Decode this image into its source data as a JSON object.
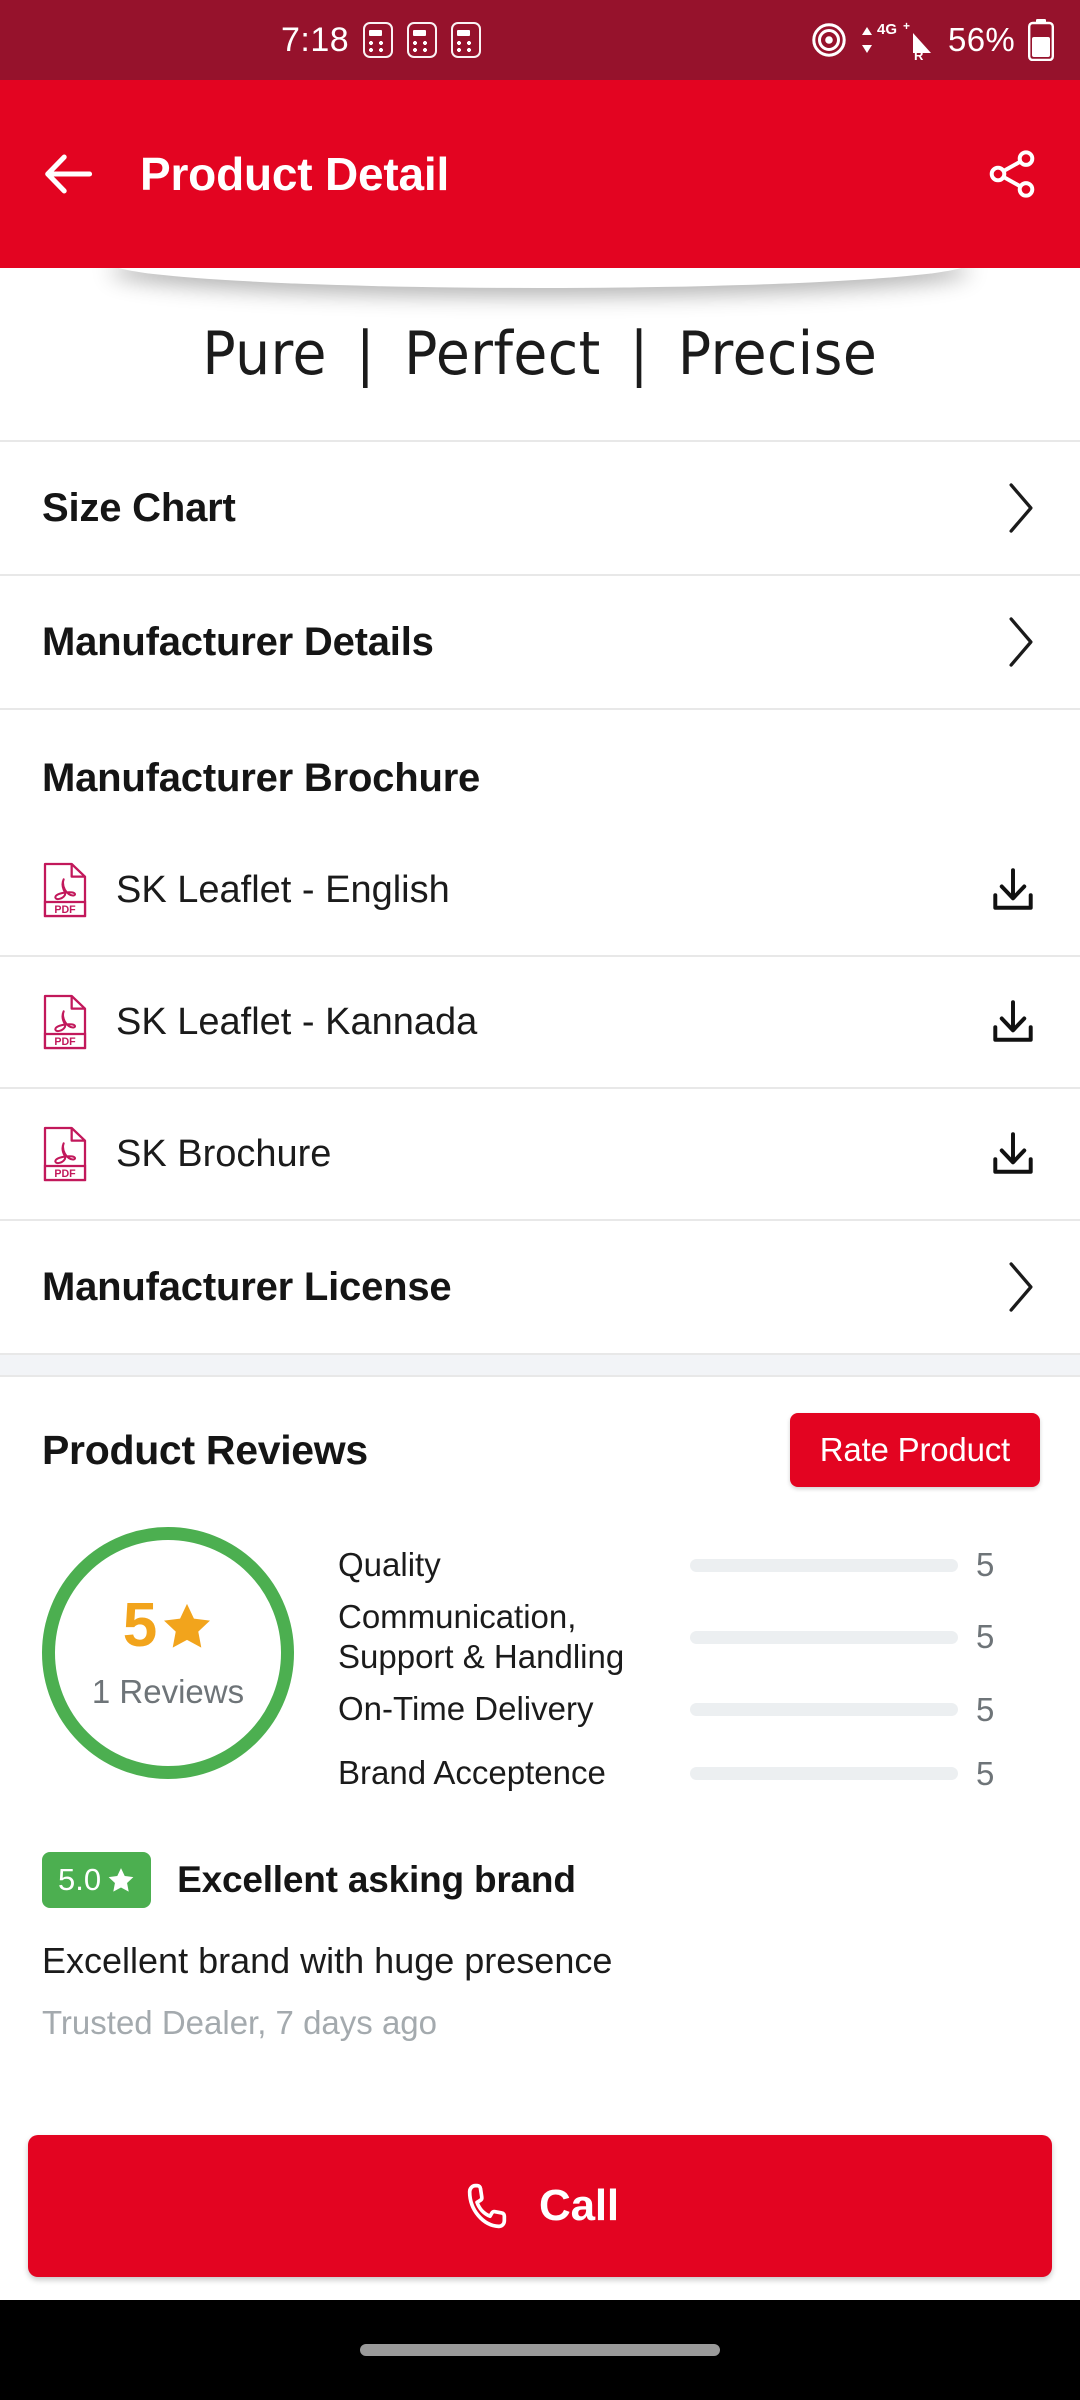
{
  "status_bar": {
    "time": "7:18",
    "notification_icons": [
      "notification-dots-icon",
      "notification-dots-icon",
      "notification-dots-icon"
    ],
    "location_icon": "location-icon",
    "network_type": "4G+",
    "roaming_label": "R",
    "battery_percent": "56%",
    "battery_icon": "battery-icon",
    "background_color": "#96122c"
  },
  "app_bar": {
    "back_icon": "back-arrow-icon",
    "title": "Product Detail",
    "share_icon": "share-icon",
    "background_color": "#e30421"
  },
  "banner": {
    "words": [
      "Pure",
      "Perfect",
      "Precise"
    ],
    "separator": "|"
  },
  "nav_rows": [
    {
      "label": "Size Chart",
      "chevron": "chevron-right-icon"
    },
    {
      "label": "Manufacturer Details",
      "chevron": "chevron-right-icon"
    }
  ],
  "brochure": {
    "heading": "Manufacturer Brochure",
    "documents": [
      {
        "name": "SK Leaflet - English",
        "file_icon": "pdf-file-icon",
        "file_type": "PDF",
        "action_icon": "download-icon"
      },
      {
        "name": "SK Leaflet - Kannada",
        "file_icon": "pdf-file-icon",
        "file_type": "PDF",
        "action_icon": "download-icon"
      },
      {
        "name": "SK Brochure",
        "file_icon": "pdf-file-icon",
        "file_type": "PDF",
        "action_icon": "download-icon"
      }
    ]
  },
  "license_row": {
    "label": "Manufacturer License",
    "chevron": "chevron-right-icon"
  },
  "reviews": {
    "title": "Product Reviews",
    "rate_button_label": "Rate Product",
    "summary": {
      "score": "5",
      "star_icon": "star-icon",
      "count_label": "1 Reviews",
      "ring_color": "#4caf50",
      "score_color": "#f2a41c"
    },
    "criteria": [
      {
        "name": "Quality",
        "value": "5",
        "max": 5
      },
      {
        "name": "Communication, Support & Handling",
        "value": "5",
        "max": 5
      },
      {
        "name": "On-Time Delivery",
        "value": "5",
        "max": 5
      },
      {
        "name": "Brand Acceptence",
        "value": "5",
        "max": 5
      }
    ],
    "items": [
      {
        "badge_score": "5.0",
        "badge_star_icon": "star-icon",
        "badge_color": "#4caf50",
        "title": "Excellent asking brand",
        "body": "Excellent brand with huge presence",
        "meta": "Trusted Dealer, 7 days ago"
      }
    ]
  },
  "call_bar": {
    "label": "Call",
    "icon": "phone-icon",
    "background_color": "#e30421"
  }
}
